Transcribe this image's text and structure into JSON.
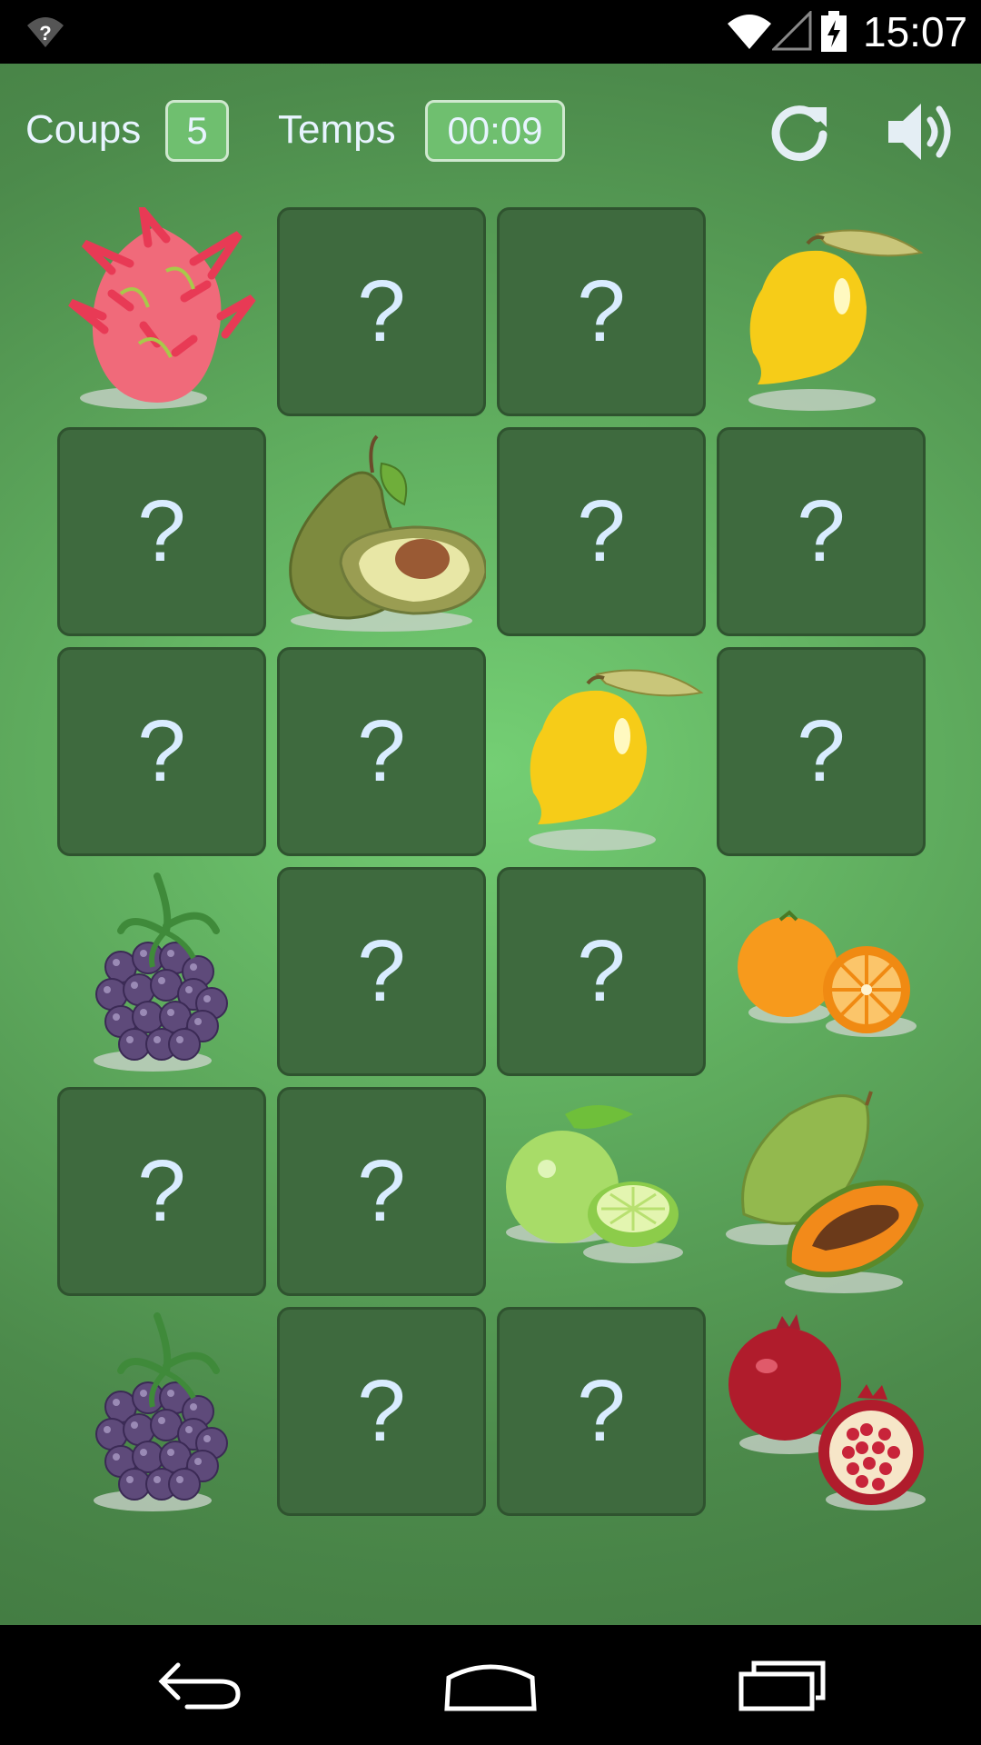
{
  "status_bar": {
    "time": "15:07",
    "icons": [
      "unknown-signal-icon",
      "wifi-icon",
      "cell-signal-icon",
      "battery-charging-icon"
    ]
  },
  "hud": {
    "moves_label": "Coups",
    "moves_value": "5",
    "time_label": "Temps",
    "time_value": "00:09",
    "restart_icon": "restart-icon",
    "sound_icon": "speaker-icon"
  },
  "board": {
    "hidden_symbol": "?",
    "rows": [
      [
        "dragon-fruit",
        "hidden",
        "hidden",
        "lemon"
      ],
      [
        "hidden",
        "avocado",
        "hidden",
        "hidden"
      ],
      [
        "hidden",
        "hidden",
        "lemon",
        "hidden"
      ],
      [
        "blackberry",
        "hidden",
        "hidden",
        "orange"
      ],
      [
        "hidden",
        "hidden",
        "lime",
        "papaya"
      ],
      [
        "blackberry",
        "hidden",
        "hidden",
        "pomegranate"
      ]
    ]
  },
  "nav_bar": {
    "icons": [
      "back-icon",
      "home-icon",
      "recent-apps-icon"
    ]
  }
}
